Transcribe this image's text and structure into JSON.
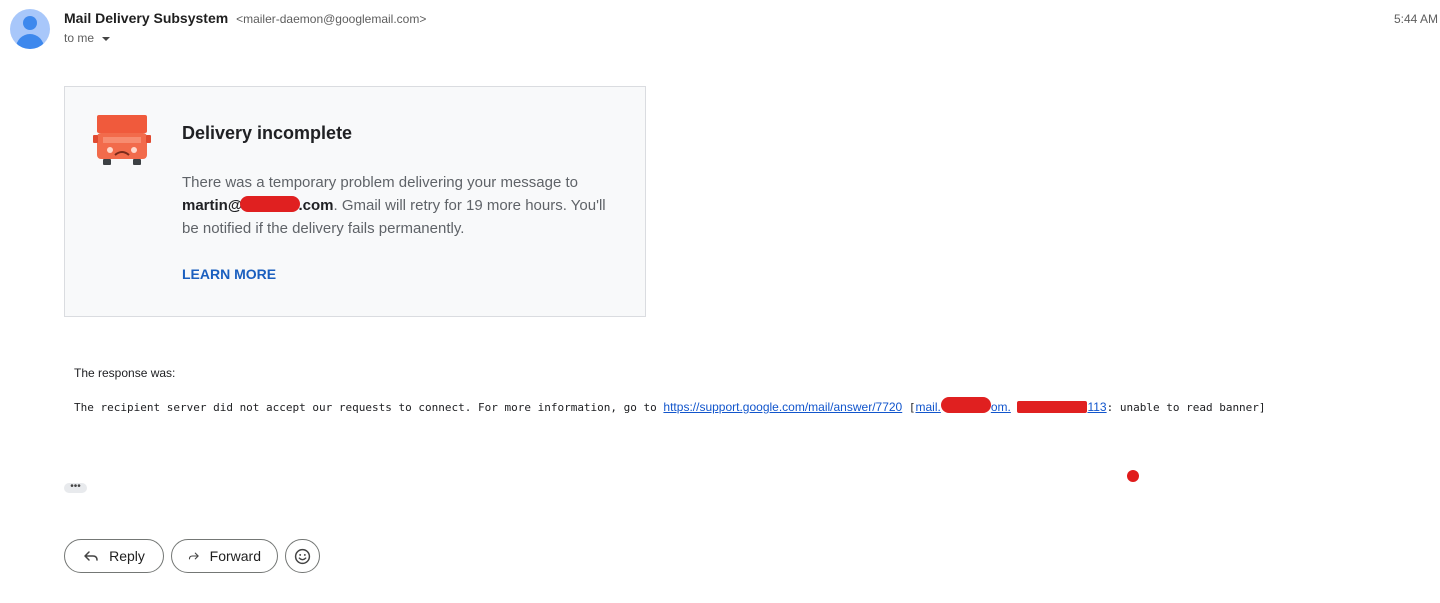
{
  "header": {
    "sender_name": "Mail Delivery Subsystem",
    "sender_email": "<mailer-daemon@googlemail.com>",
    "recipient": "to me",
    "time": "5:44 AM"
  },
  "card": {
    "title": "Delivery incomplete",
    "body_pre": "There was a temporary problem delivering your message to ",
    "recipient_prefix": "martin@",
    "recipient_suffix": ".com",
    "body_post": ". Gmail will retry for 19 more hours. You'll be notified if the delivery fails permanently.",
    "learn_more": "LEARN MORE"
  },
  "response": {
    "label": "The response was:",
    "text_pre": "The recipient server did not accept our requests to connect. For more information, go to ",
    "link": "https://support.google.com/mail/answer/7720",
    "bracket_open": " [",
    "host_prefix": "mail.",
    "host_suffix": "om.",
    "ip_suffix": "113",
    "text_post": ": unable to read banner]"
  },
  "trimmed_indicator": "•••",
  "actions": {
    "reply": "Reply",
    "forward": "Forward"
  },
  "colors": {
    "accent": "#1a5fbf",
    "truck": "#f26b4b",
    "redaction": "#e02020"
  },
  "icons": [
    "person-icon",
    "truck-sad-icon",
    "reply-icon",
    "forward-icon",
    "emoji-icon"
  ]
}
